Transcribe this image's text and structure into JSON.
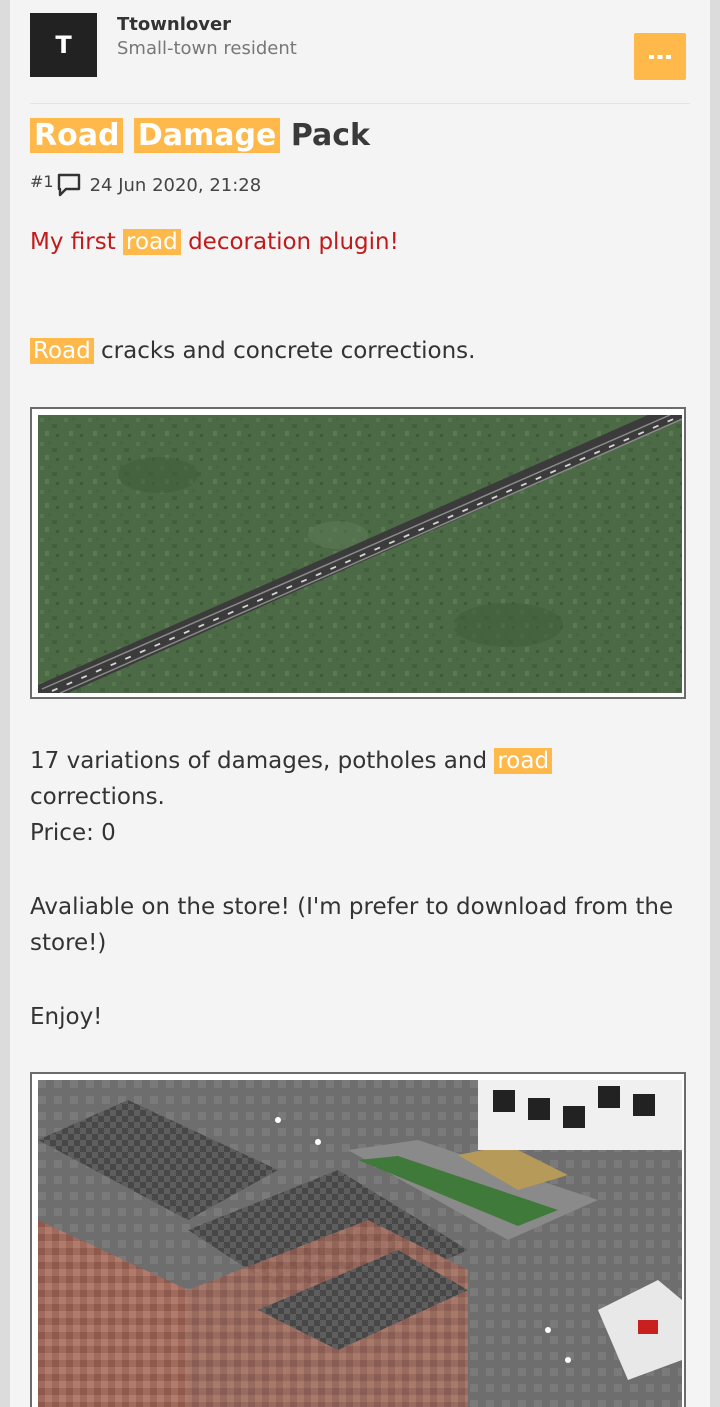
{
  "post": {
    "author": {
      "avatar_letter": "T",
      "name": "Ttownlover",
      "title": "Small-town resident"
    },
    "menu_icon": "more-dots-icon",
    "title_words": [
      "Road",
      "Damage",
      "Pack"
    ],
    "post_number": "#1",
    "date": "24 Jun 2020, 21:28",
    "intro": {
      "before": "My first",
      "highlight": "road",
      "after": "decoration plugin!"
    },
    "desc": {
      "highlight": "Road",
      "after": "cracks and concrete corrections."
    },
    "variations": {
      "before": "17 variations of damages, potholes and",
      "highlight": "road",
      "after": "corrections."
    },
    "price": "Price: 0",
    "store_line1": "Avaliable on the store! (I'm prefer to download from the",
    "store_line2": "store!)",
    "enjoy": "Enjoy!"
  },
  "colors": {
    "accent": "#ffb84a",
    "intro_text": "#c21a1a"
  }
}
